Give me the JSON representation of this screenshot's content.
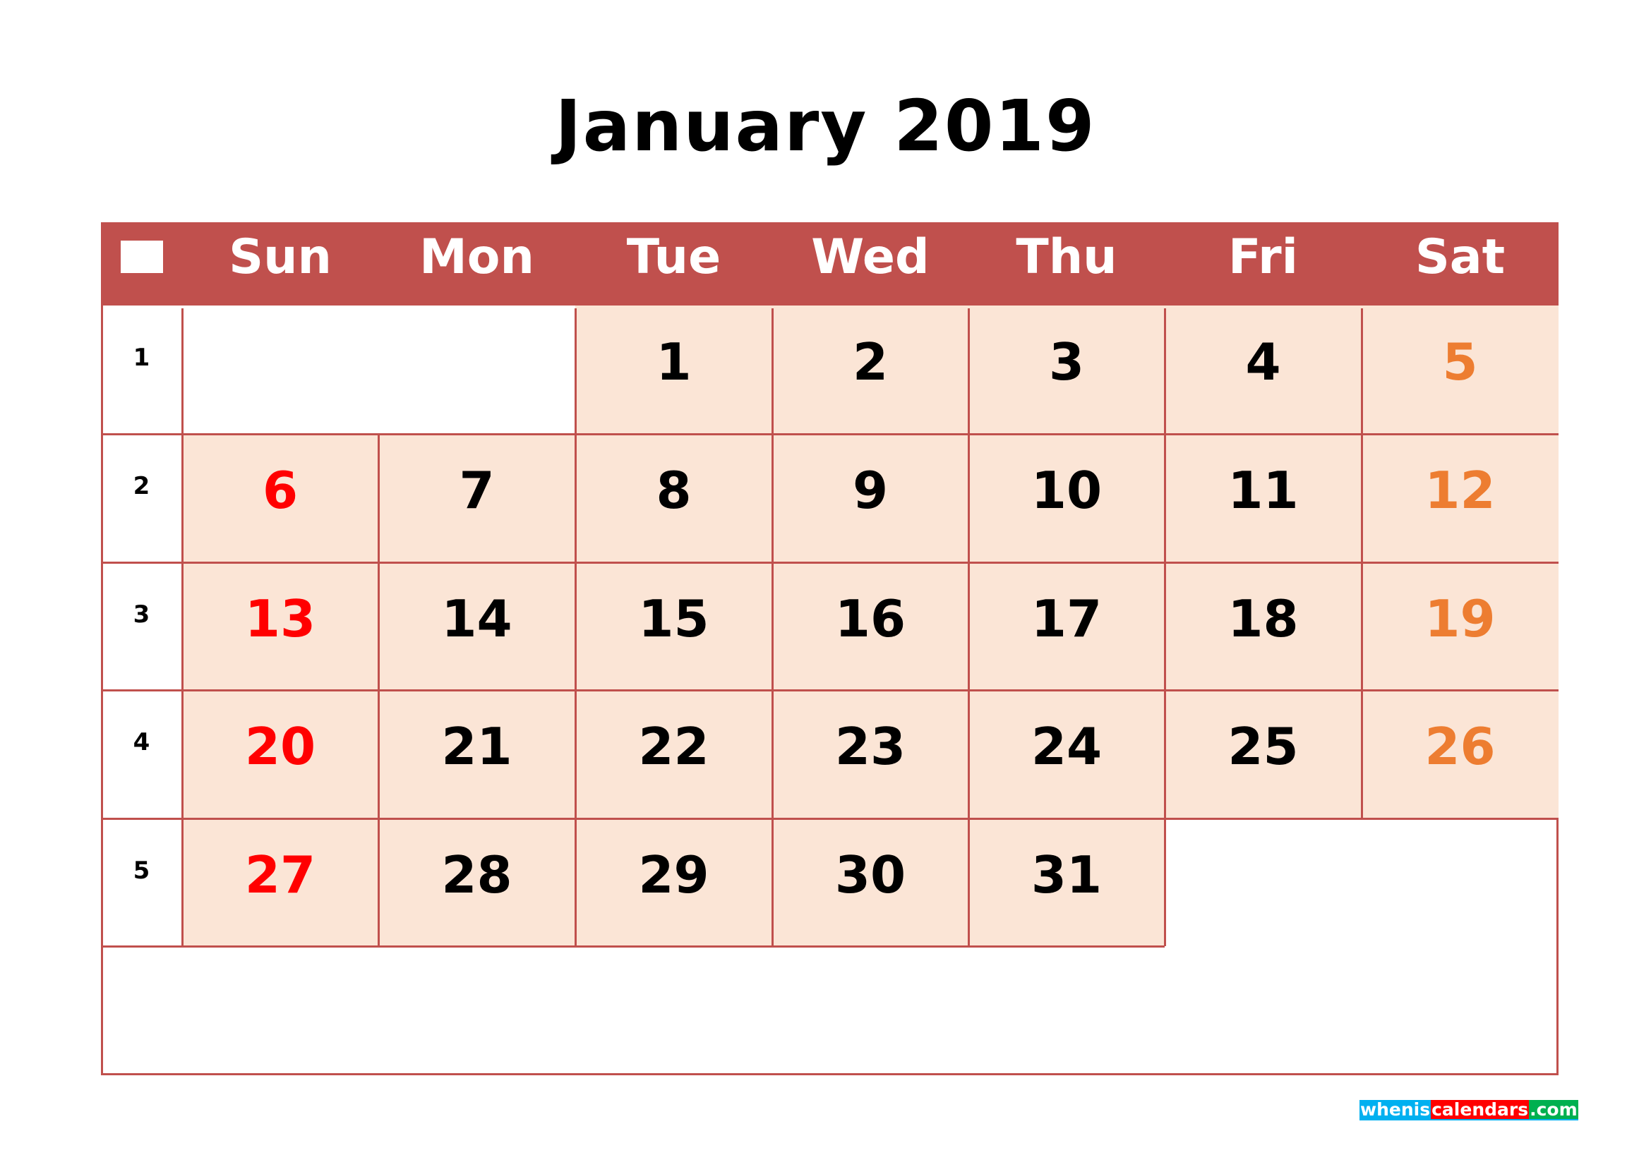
{
  "title": "January 2019",
  "header": {
    "week_icon": "week-column-marker",
    "days": [
      "Sun",
      "Mon",
      "Tue",
      "Wed",
      "Thu",
      "Fri",
      "Sat"
    ]
  },
  "colors": {
    "header_bg": "#c0504d",
    "grid_line": "#c0504d",
    "cell_fill": "#fbe5d6",
    "sunday_text": "#ff0000",
    "saturday_text": "#ed7d31",
    "weekday_text": "#000000"
  },
  "weeks": [
    {
      "week": "1",
      "days": [
        "",
        "",
        "1",
        "2",
        "3",
        "4",
        "5"
      ]
    },
    {
      "week": "2",
      "days": [
        "6",
        "7",
        "8",
        "9",
        "10",
        "11",
        "12"
      ]
    },
    {
      "week": "3",
      "days": [
        "13",
        "14",
        "15",
        "16",
        "17",
        "18",
        "19"
      ]
    },
    {
      "week": "4",
      "days": [
        "20",
        "21",
        "22",
        "23",
        "24",
        "25",
        "26"
      ]
    },
    {
      "week": "5",
      "days": [
        "27",
        "28",
        "29",
        "30",
        "31",
        "",
        ""
      ]
    }
  ],
  "logo": {
    "part1": "whenis",
    "part2": "calendars",
    "part3": ".com"
  }
}
